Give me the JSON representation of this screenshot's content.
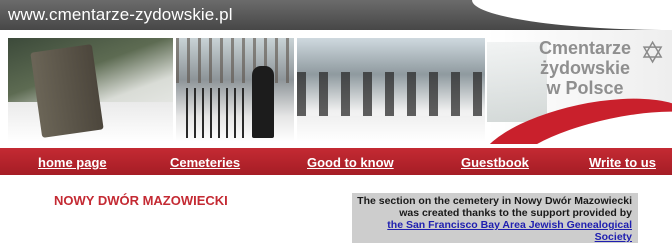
{
  "header": {
    "site_url": "www.cmentarze-zydowskie.pl"
  },
  "logo": {
    "line1": "Cmentarze",
    "line2": "żydowskie",
    "line3": "w Polsce",
    "icon": "star-of-david-icon"
  },
  "nav": {
    "items": [
      {
        "label": "home page"
      },
      {
        "label": "Cemeteries"
      },
      {
        "label": "Good to know"
      },
      {
        "label": "Guestbook"
      },
      {
        "label": "Write to us"
      }
    ]
  },
  "main": {
    "title": "NOWY DWÓR MAZOWIECKI",
    "sponsor_text_1": "The section on the cemetery in Nowy Dwór Mazowiecki",
    "sponsor_text_2": "was created thanks to the support provided by",
    "sponsor_link_1": "the San Francisco Bay Area Jewish Genealogical",
    "sponsor_link_2": "Society"
  },
  "colors": {
    "nav_red": "#b3232c",
    "title_red": "#c42a33",
    "topbar_gray": "#555555",
    "sponsor_box_gray": "#cdcdcd",
    "link_blue": "#1f1fb0"
  }
}
